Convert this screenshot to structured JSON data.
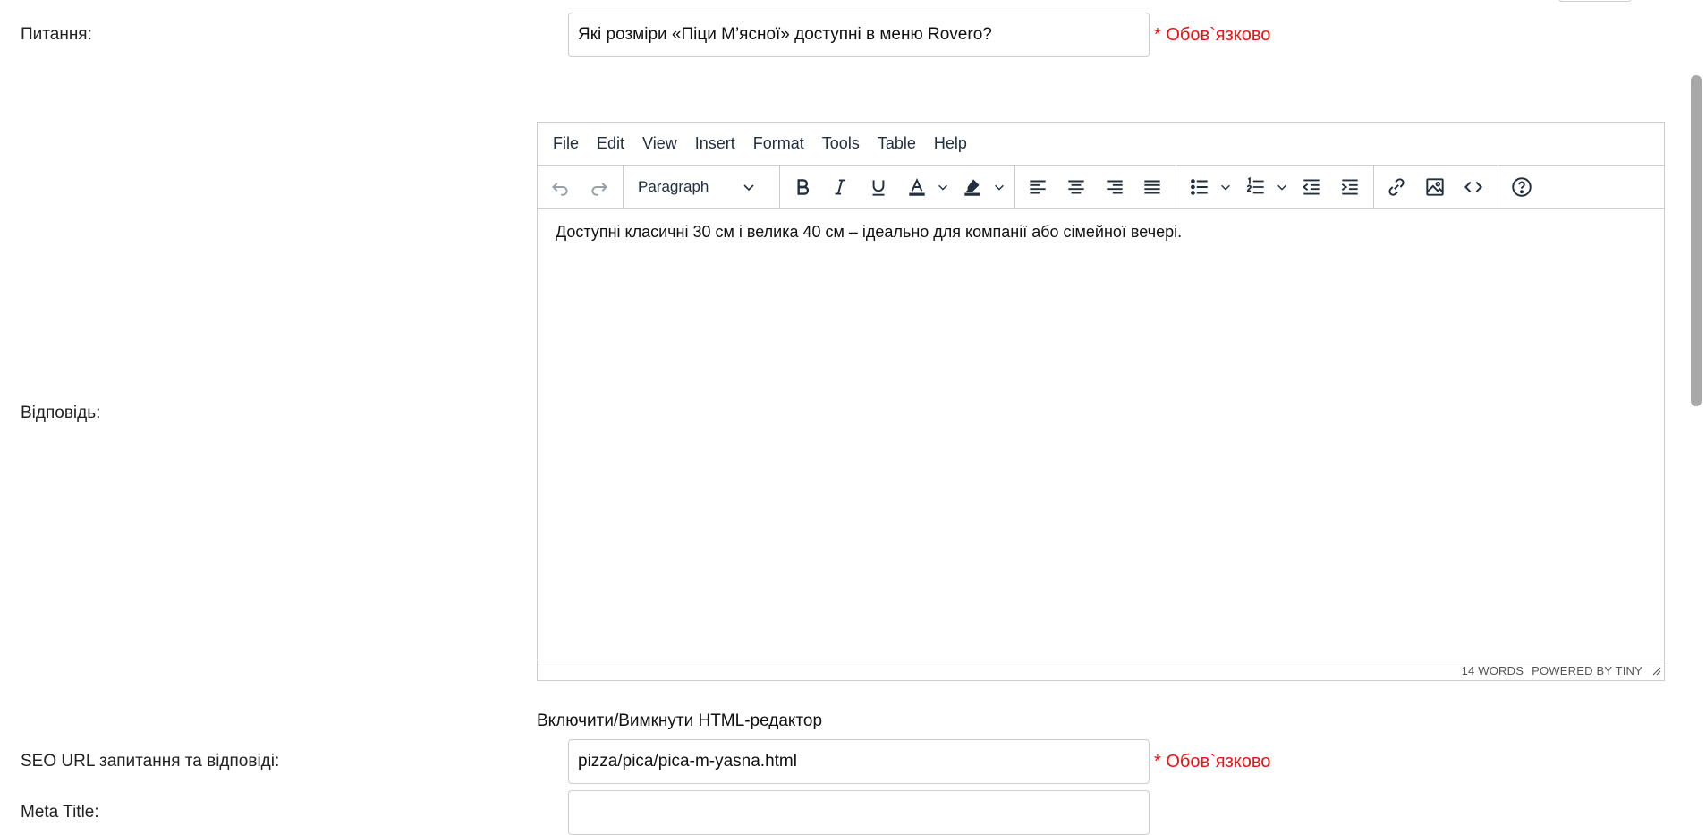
{
  "form": {
    "question_label": "Питання:",
    "question_value": "Які розміри «Піци М’ясної» доступні в меню Rovero?",
    "required_text": "* Обов`язково",
    "answer_label": "Відповідь:",
    "seo_label": "SEO URL запитання та відповіді:",
    "seo_value": "pizza/pica/pica-m-yasna.html",
    "meta_title_label": "Meta Title:",
    "meta_title_value": "",
    "html_toggle": "Включити/Вимкнути HTML-редактор"
  },
  "editor": {
    "menu": [
      "File",
      "Edit",
      "View",
      "Insert",
      "Format",
      "Tools",
      "Table",
      "Help"
    ],
    "block_format": "Paragraph",
    "toolbar_icons": [
      "undo-icon",
      "redo-icon",
      "bold-icon",
      "italic-icon",
      "underline-icon",
      "text-color-icon",
      "highlight-color-icon",
      "align-left-icon",
      "align-center-icon",
      "align-right-icon",
      "align-justify-icon",
      "bullet-list-icon",
      "numbered-list-icon",
      "outdent-icon",
      "indent-icon",
      "link-icon",
      "image-icon",
      "source-code-icon",
      "help-icon"
    ],
    "content": "Доступні класичні 30 см і велика 40 см – ідеально для компанії або сімейної вечері.",
    "word_count": "14 WORDS",
    "powered_by": "POWERED BY TINY"
  },
  "colors": {
    "required": "#ee1111",
    "text": "#222f3e",
    "border": "#cccccc"
  }
}
